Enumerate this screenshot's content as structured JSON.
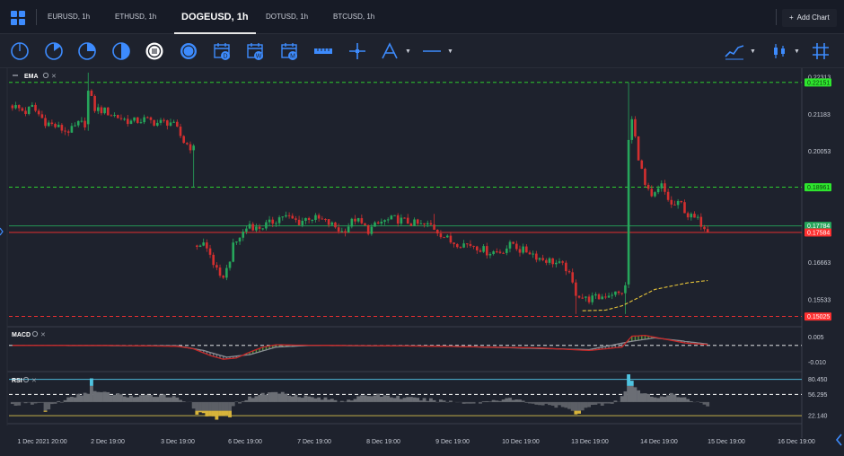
{
  "tabs": [
    {
      "label": "EURUSD, 1h",
      "active": false
    },
    {
      "label": "ETHUSD, 1h",
      "active": false
    },
    {
      "label": "DOGEUSD, 1h",
      "active": true
    },
    {
      "label": "DOTUSD, 1h",
      "active": false
    },
    {
      "label": "BTCUSD, 1h",
      "active": false
    }
  ],
  "add_chart_label": "Add Chart",
  "toolbar_icons": [
    "clock-1m-icon",
    "clock-5m-icon",
    "clock-15m-icon",
    "clock-30m-icon",
    "clock-1h-icon",
    "clock-4h-icon",
    "calendar-day-icon",
    "calendar-week-icon",
    "calendar-month-icon",
    "ruler-icon",
    "crosshair-icon",
    "fib-tool-icon",
    "horizontal-line-icon",
    "line-chart-type-icon",
    "candle-type-icon",
    "grid-toggle-icon"
  ],
  "colors": {
    "up": "#26a65b",
    "down": "#d32f2f",
    "accent": "#3d8bfd",
    "level": "#2ee62e",
    "sell": "#ff3030"
  },
  "chart_data": [
    {
      "panel": "price",
      "type": "candlestick",
      "indicator_label": "EMA",
      "y_ticks": [
        0.22313,
        0.21183,
        0.20053,
        0.18923,
        0.17784,
        0.16663,
        0.15533
      ],
      "ylim": [
        0.1485,
        0.2242
      ],
      "price_labels": [
        {
          "value": 0.22151,
          "text": "0.22151",
          "color": "#2ee62e"
        },
        {
          "value": 0.18961,
          "text": "0.18961",
          "color": "#2ee62e"
        },
        {
          "value": 0.17784,
          "text": "0.17784",
          "color": "#26a65b"
        },
        {
          "value": 0.17584,
          "text": "0.17584",
          "color": "#ff3030"
        },
        {
          "value": 0.15025,
          "text": "0.15025",
          "color": "#ff3030"
        }
      ],
      "x_ticks": [
        "1 Dec 2021 20:00",
        "2 Dec 19:00",
        "3 Dec 19:00",
        "6 Dec 19:00",
        "7 Dec 19:00",
        "8 Dec 19:00",
        "9 Dec 19:00",
        "10 Dec 19:00",
        "13 Dec 19:00",
        "14 Dec 19:00",
        "15 Dec 19:00",
        "16 Dec 19:00"
      ],
      "anchors": [
        [
          0,
          0.2145
        ],
        [
          4,
          0.2125
        ],
        [
          6,
          0.214
        ],
        [
          10,
          0.2095
        ],
        [
          16,
          0.2068
        ],
        [
          18,
          0.207
        ],
        [
          20,
          0.2088
        ],
        [
          22,
          0.209
        ],
        [
          23,
          0.219
        ],
        [
          25,
          0.2135
        ],
        [
          28,
          0.2128
        ],
        [
          32,
          0.211
        ],
        [
          36,
          0.2095
        ],
        [
          40,
          0.2102
        ],
        [
          44,
          0.2092
        ],
        [
          48,
          0.2095
        ],
        [
          50,
          0.207
        ],
        [
          52,
          0.2035
        ],
        [
          55,
          0.2012
        ],
        [
          56,
          0.172
        ],
        [
          58,
          0.1725
        ],
        [
          60,
          0.169
        ],
        [
          63,
          0.1615
        ],
        [
          65,
          0.1645
        ],
        [
          67,
          0.1715
        ],
        [
          69,
          0.1745
        ],
        [
          72,
          0.1785
        ],
        [
          74,
          0.177
        ],
        [
          78,
          0.1785
        ],
        [
          82,
          0.181
        ],
        [
          87,
          0.179
        ],
        [
          90,
          0.1805
        ],
        [
          94,
          0.1795
        ],
        [
          98,
          0.1775
        ],
        [
          100,
          0.176
        ],
        [
          104,
          0.18
        ],
        [
          108,
          0.1765
        ],
        [
          112,
          0.179
        ],
        [
          116,
          0.18
        ],
        [
          120,
          0.179
        ],
        [
          124,
          0.178
        ],
        [
          127,
          0.178
        ],
        [
          130,
          0.1755
        ],
        [
          133,
          0.173
        ],
        [
          136,
          0.1725
        ],
        [
          140,
          0.172
        ],
        [
          144,
          0.17
        ],
        [
          148,
          0.17
        ],
        [
          152,
          0.1725
        ],
        [
          154,
          0.1705
        ],
        [
          157,
          0.17
        ],
        [
          160,
          0.168
        ],
        [
          164,
          0.167
        ],
        [
          168,
          0.165
        ],
        [
          171,
          0.1575
        ],
        [
          174,
          0.1555
        ],
        [
          178,
          0.156
        ],
        [
          182,
          0.1575
        ],
        [
          184,
          0.157
        ],
        [
          186,
          0.159
        ],
        [
          187,
          0.204
        ],
        [
          188,
          0.21
        ],
        [
          190,
          0.199
        ],
        [
          192,
          0.19
        ],
        [
          194,
          0.186
        ],
        [
          197,
          0.19
        ],
        [
          200,
          0.184
        ],
        [
          203,
          0.1845
        ],
        [
          205,
          0.181
        ],
        [
          208,
          0.1795
        ],
        [
          211,
          0.177
        ]
      ],
      "spikes": [
        {
          "i": 23,
          "high": 0.2245
        },
        {
          "i": 55,
          "low": 0.1895
        },
        {
          "i": 186,
          "low": 0.151
        },
        {
          "i": 187,
          "high": 0.2215
        },
        {
          "i": 128,
          "high": 0.1815
        },
        {
          "i": 171,
          "low": 0.151
        }
      ],
      "ema": [
        [
          173,
          0.152
        ],
        [
          180,
          0.1522
        ],
        [
          185,
          0.1535
        ],
        [
          190,
          0.156
        ],
        [
          195,
          0.1585
        ],
        [
          200,
          0.1595
        ],
        [
          205,
          0.1605
        ],
        [
          211,
          0.1612
        ]
      ],
      "levels": [
        {
          "value": 0.22151,
          "color": "#2ee62e",
          "dash": true
        },
        {
          "value": 0.18961,
          "color": "#2ee62e",
          "dash": true
        },
        {
          "value": 0.17784,
          "color": "#26a65b",
          "dash": false
        },
        {
          "value": 0.17584,
          "color": "#ff3030",
          "dash": false
        },
        {
          "value": 0.15025,
          "color": "#ff3030",
          "dash": true
        }
      ]
    },
    {
      "panel": "macd",
      "type": "line",
      "indicator_label": "MACD",
      "y_ticks": [
        0.005,
        -0.01
      ],
      "ylim": [
        -0.014,
        0.009
      ],
      "zero_line": 0.0,
      "macd": [
        [
          0,
          0.0
        ],
        [
          30,
          0.0
        ],
        [
          50,
          -0.0005
        ],
        [
          55,
          -0.002
        ],
        [
          60,
          -0.006
        ],
        [
          64,
          -0.0082
        ],
        [
          68,
          -0.0075
        ],
        [
          72,
          -0.004
        ],
        [
          76,
          -0.001
        ],
        [
          80,
          0.0004
        ],
        [
          86,
          0.0002
        ],
        [
          100,
          0.0
        ],
        [
          130,
          -0.0005
        ],
        [
          160,
          -0.0015
        ],
        [
          175,
          -0.003
        ],
        [
          185,
          -0.001
        ],
        [
          188,
          0.0055
        ],
        [
          192,
          0.006
        ],
        [
          196,
          0.0045
        ],
        [
          204,
          0.0015
        ],
        [
          211,
          0.0005
        ]
      ],
      "signal": [
        [
          0,
          0.0
        ],
        [
          50,
          -0.0002
        ],
        [
          58,
          -0.003
        ],
        [
          65,
          -0.007
        ],
        [
          72,
          -0.0055
        ],
        [
          80,
          -0.001
        ],
        [
          90,
          0.0
        ],
        [
          130,
          -0.0004
        ],
        [
          175,
          -0.0025
        ],
        [
          188,
          0.0025
        ],
        [
          195,
          0.0045
        ],
        [
          204,
          0.0025
        ],
        [
          211,
          0.0008
        ]
      ]
    },
    {
      "panel": "rsi",
      "type": "area",
      "indicator_label": "RSI",
      "y_ticks": [
        80.45,
        56.295,
        22.14
      ],
      "ylim": [
        15,
        90
      ],
      "bands": [
        80.45,
        56.295,
        22.14
      ],
      "values": [
        [
          0,
          40
        ],
        [
          9,
          42
        ],
        [
          10,
          28
        ],
        [
          12,
          40
        ],
        [
          23,
          60
        ],
        [
          24,
          82
        ],
        [
          25,
          60
        ],
        [
          38,
          52
        ],
        [
          46,
          56
        ],
        [
          54,
          44
        ],
        [
          56,
          26
        ],
        [
          62,
          18
        ],
        [
          66,
          22
        ],
        [
          67,
          40
        ],
        [
          74,
          55
        ],
        [
          80,
          60
        ],
        [
          90,
          52
        ],
        [
          100,
          46
        ],
        [
          110,
          56
        ],
        [
          120,
          50
        ],
        [
          130,
          46
        ],
        [
          140,
          42
        ],
        [
          150,
          50
        ],
        [
          160,
          40
        ],
        [
          168,
          35
        ],
        [
          171,
          24
        ],
        [
          174,
          36
        ],
        [
          180,
          42
        ],
        [
          184,
          46
        ],
        [
          186,
          60
        ],
        [
          187,
          86
        ],
        [
          188,
          78
        ],
        [
          190,
          60
        ],
        [
          195,
          52
        ],
        [
          200,
          56
        ],
        [
          205,
          48
        ],
        [
          211,
          40
        ]
      ]
    }
  ]
}
